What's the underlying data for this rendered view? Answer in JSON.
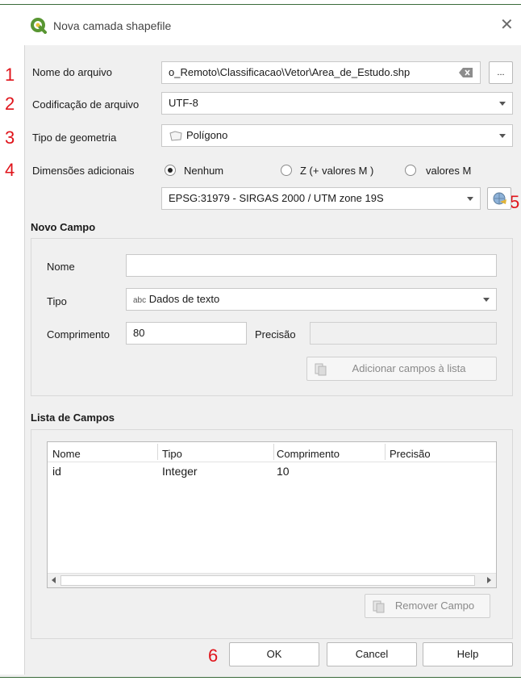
{
  "window": {
    "title": "Nova camada shapefile",
    "close_glyph": "✕"
  },
  "annotations": [
    "1",
    "2",
    "3",
    "4",
    "5",
    "6"
  ],
  "form": {
    "filename_label": "Nome do arquivo",
    "filename_value": "o_Remoto\\Classificacao\\Vetor\\Area_de_Estudo.shp",
    "browse_label": "...",
    "encoding_label": "Codificação de arquivo",
    "encoding_value": "UTF-8",
    "geometry_label": "Tipo de geometria",
    "geometry_value": "Polígono",
    "dimensions_label": "Dimensões adicionais",
    "dimension_options": [
      "Nenhum",
      "Z (+ valores M )",
      "valores M"
    ],
    "dimension_selected": "Nenhum",
    "crs_value": "EPSG:31979 - SIRGAS 2000 / UTM zone 19S"
  },
  "new_field": {
    "group_title": "Novo Campo",
    "name_label": "Nome",
    "name_value": "",
    "type_label": "Tipo",
    "type_prefix": "abc",
    "type_value": "Dados de texto",
    "length_label": "Comprimento",
    "length_value": "80",
    "precision_label": "Precisão",
    "precision_value": "",
    "add_button": "Adicionar campos à lista"
  },
  "field_list": {
    "group_title": "Lista de Campos",
    "columns": [
      "Nome",
      "Tipo",
      "Comprimento",
      "Precisão"
    ],
    "rows": [
      [
        "id",
        "Integer",
        "10",
        ""
      ]
    ],
    "remove_button": "Remover Campo"
  },
  "buttons": {
    "ok": "OK",
    "cancel": "Cancel",
    "help": "Help"
  },
  "icons": {
    "app": "qgis-logo-icon",
    "clear": "clear-text-icon",
    "polygon": "polygon-icon",
    "crs": "crs-select-icon",
    "add": "add-field-icon",
    "remove": "remove-field-icon"
  },
  "colors": {
    "annotation": "#e0141b",
    "window_bg": "#f0f0f0",
    "qgis_green": "#589632"
  }
}
